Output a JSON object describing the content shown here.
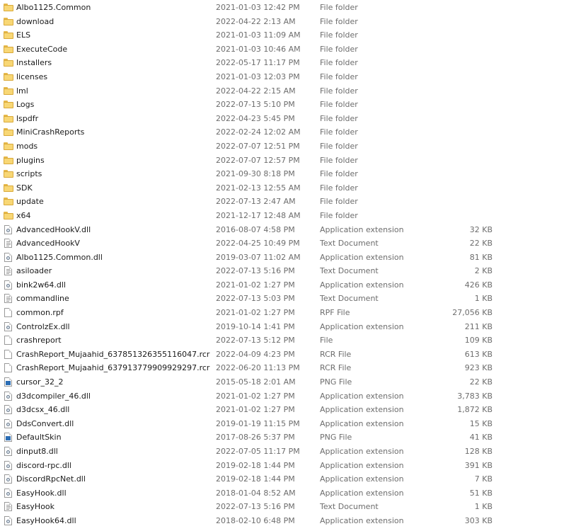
{
  "files": [
    {
      "name": "Albo1125.Common",
      "date": "2021-01-03 12:42 PM",
      "type": "File folder",
      "size": "",
      "icon": "folder-icon"
    },
    {
      "name": "download",
      "date": "2022-04-22 2:13 AM",
      "type": "File folder",
      "size": "",
      "icon": "folder-icon"
    },
    {
      "name": "ELS",
      "date": "2021-01-03 11:09 AM",
      "type": "File folder",
      "size": "",
      "icon": "folder-icon"
    },
    {
      "name": "ExecuteCode",
      "date": "2021-01-03 10:46 AM",
      "type": "File folder",
      "size": "",
      "icon": "folder-icon"
    },
    {
      "name": "Installers",
      "date": "2022-05-17 11:17 PM",
      "type": "File folder",
      "size": "",
      "icon": "folder-icon"
    },
    {
      "name": "licenses",
      "date": "2021-01-03 12:03 PM",
      "type": "File folder",
      "size": "",
      "icon": "folder-icon"
    },
    {
      "name": "lml",
      "date": "2022-04-22 2:15 AM",
      "type": "File folder",
      "size": "",
      "icon": "folder-icon"
    },
    {
      "name": "Logs",
      "date": "2022-07-13 5:10 PM",
      "type": "File folder",
      "size": "",
      "icon": "folder-icon"
    },
    {
      "name": "lspdfr",
      "date": "2022-04-23 5:45 PM",
      "type": "File folder",
      "size": "",
      "icon": "folder-icon"
    },
    {
      "name": "MiniCrashReports",
      "date": "2022-02-24 12:02 AM",
      "type": "File folder",
      "size": "",
      "icon": "folder-icon"
    },
    {
      "name": "mods",
      "date": "2022-07-07 12:51 PM",
      "type": "File folder",
      "size": "",
      "icon": "folder-icon"
    },
    {
      "name": "plugins",
      "date": "2022-07-07 12:57 PM",
      "type": "File folder",
      "size": "",
      "icon": "folder-icon"
    },
    {
      "name": "scripts",
      "date": "2021-09-30 8:18 PM",
      "type": "File folder",
      "size": "",
      "icon": "folder-icon"
    },
    {
      "name": "SDK",
      "date": "2021-02-13 12:55 AM",
      "type": "File folder",
      "size": "",
      "icon": "folder-icon"
    },
    {
      "name": "update",
      "date": "2022-07-13 2:47 AM",
      "type": "File folder",
      "size": "",
      "icon": "folder-icon"
    },
    {
      "name": "x64",
      "date": "2021-12-17 12:48 AM",
      "type": "File folder",
      "size": "",
      "icon": "folder-icon"
    },
    {
      "name": "AdvancedHookV.dll",
      "date": "2016-08-07 4:58 PM",
      "type": "Application extension",
      "size": "32 KB",
      "icon": "dll-file-icon"
    },
    {
      "name": "AdvancedHookV",
      "date": "2022-04-25 10:49 PM",
      "type": "Text Document",
      "size": "22 KB",
      "icon": "text-file-icon"
    },
    {
      "name": "Albo1125.Common.dll",
      "date": "2019-03-07 11:02 AM",
      "type": "Application extension",
      "size": "81 KB",
      "icon": "dll-file-icon"
    },
    {
      "name": "asiloader",
      "date": "2022-07-13 5:16 PM",
      "type": "Text Document",
      "size": "2 KB",
      "icon": "text-file-icon"
    },
    {
      "name": "bink2w64.dll",
      "date": "2021-01-02 1:27 PM",
      "type": "Application extension",
      "size": "426 KB",
      "icon": "dll-file-icon"
    },
    {
      "name": "commandline",
      "date": "2022-07-13 5:03 PM",
      "type": "Text Document",
      "size": "1 KB",
      "icon": "text-file-icon"
    },
    {
      "name": "common.rpf",
      "date": "2021-01-02 1:27 PM",
      "type": "RPF File",
      "size": "27,056 KB",
      "icon": "generic-file-icon"
    },
    {
      "name": "ControlzEx.dll",
      "date": "2019-10-14 1:41 PM",
      "type": "Application extension",
      "size": "211 KB",
      "icon": "dll-file-icon"
    },
    {
      "name": "crashreport",
      "date": "2022-07-13 5:12 PM",
      "type": "File",
      "size": "109 KB",
      "icon": "generic-file-icon"
    },
    {
      "name": "CrashReport_Mujaahid_637851326355116047.rcr",
      "date": "2022-04-09 4:23 PM",
      "type": "RCR File",
      "size": "613 KB",
      "icon": "generic-file-icon"
    },
    {
      "name": "CrashReport_Mujaahid_637913779909929297.rcr",
      "date": "2022-06-20 11:13 PM",
      "type": "RCR File",
      "size": "923 KB",
      "icon": "generic-file-icon"
    },
    {
      "name": "cursor_32_2",
      "date": "2015-05-18 2:01 AM",
      "type": "PNG File",
      "size": "22 KB",
      "icon": "png-file-icon"
    },
    {
      "name": "d3dcompiler_46.dll",
      "date": "2021-01-02 1:27 PM",
      "type": "Application extension",
      "size": "3,783 KB",
      "icon": "dll-file-icon"
    },
    {
      "name": "d3dcsx_46.dll",
      "date": "2021-01-02 1:27 PM",
      "type": "Application extension",
      "size": "1,872 KB",
      "icon": "dll-file-icon"
    },
    {
      "name": "DdsConvert.dll",
      "date": "2019-01-19 11:15 PM",
      "type": "Application extension",
      "size": "15 KB",
      "icon": "dll-file-icon"
    },
    {
      "name": "DefaultSkin",
      "date": "2017-08-26 5:37 PM",
      "type": "PNG File",
      "size": "41 KB",
      "icon": "png-file-icon"
    },
    {
      "name": "dinput8.dll",
      "date": "2022-07-05 11:17 PM",
      "type": "Application extension",
      "size": "128 KB",
      "icon": "dll-file-icon"
    },
    {
      "name": "discord-rpc.dll",
      "date": "2019-02-18 1:44 PM",
      "type": "Application extension",
      "size": "391 KB",
      "icon": "dll-file-icon"
    },
    {
      "name": "DiscordRpcNet.dll",
      "date": "2019-02-18 1:44 PM",
      "type": "Application extension",
      "size": "7 KB",
      "icon": "dll-file-icon"
    },
    {
      "name": "EasyHook.dll",
      "date": "2018-01-04 8:52 AM",
      "type": "Application extension",
      "size": "51 KB",
      "icon": "dll-file-icon"
    },
    {
      "name": "EasyHook",
      "date": "2022-07-13 5:16 PM",
      "type": "Text Document",
      "size": "1 KB",
      "icon": "text-file-icon"
    },
    {
      "name": "EasyHook64.dll",
      "date": "2018-02-10 6:48 PM",
      "type": "Application extension",
      "size": "303 KB",
      "icon": "dll-file-icon"
    }
  ]
}
